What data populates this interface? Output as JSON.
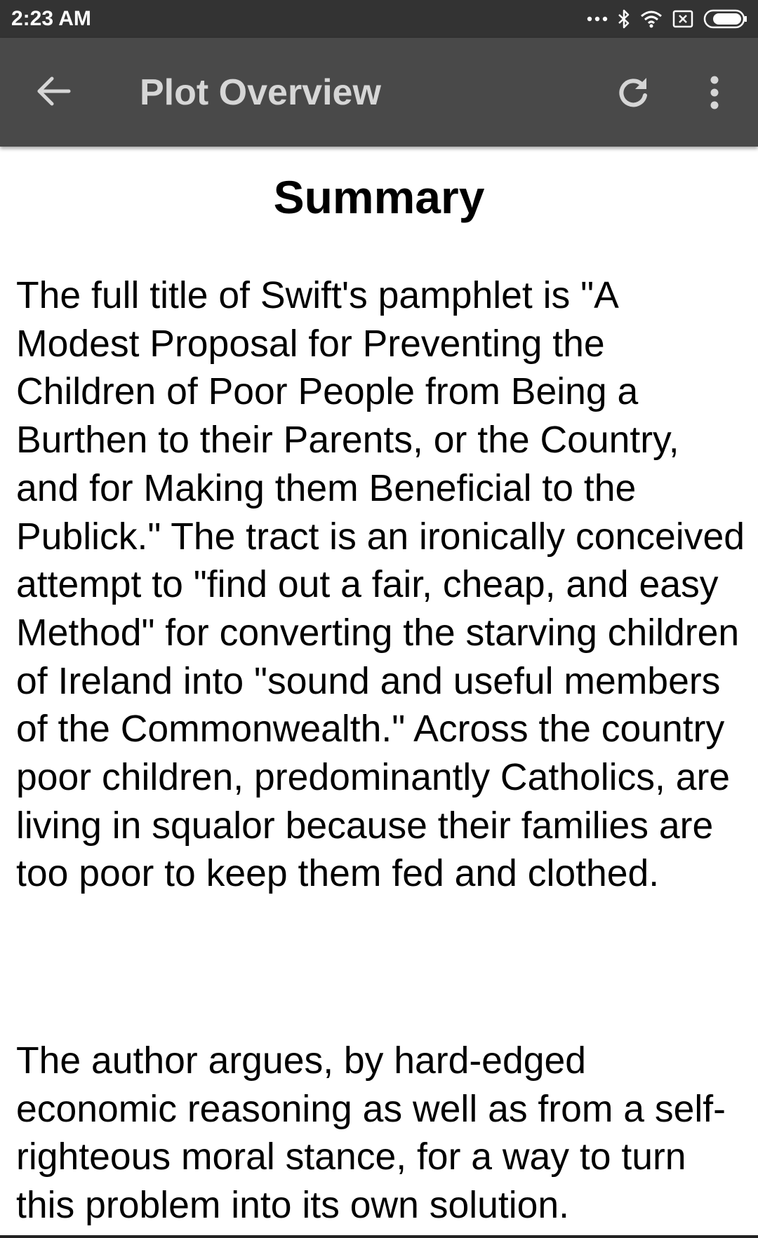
{
  "status_bar": {
    "time": "2:23 AM",
    "icons": [
      "more-dots-icon",
      "bluetooth-icon",
      "wifi-icon",
      "sim-x-icon",
      "battery-icon"
    ]
  },
  "app_bar": {
    "back_icon": "arrow-back-icon",
    "title": "Plot Overview",
    "refresh_icon": "refresh-icon",
    "menu_icon": "more-vert-icon",
    "background": "#494949",
    "title_color": "#d6d6d6"
  },
  "content": {
    "heading": "Summary",
    "paragraphs": [
      "The full title of Swift's pamphlet is \"A Modest Proposal for Preventing the Children of Poor People from Being a Burthen to their Parents, or the Country, and for Making them Beneficial to the Publick.\" The tract is an ironically conceived attempt to \"find out a fair, cheap, and easy Method\" for converting the starving children of Ireland into \"sound and useful members of the Commonwealth.\" Across the country poor children, predominantly Catholics, are living in squalor because their families are too poor to keep them fed and clothed.",
      "The author argues, by hard-edged economic reasoning as well as from a self-righteous moral stance, for a way to turn this problem into its own solution."
    ]
  }
}
